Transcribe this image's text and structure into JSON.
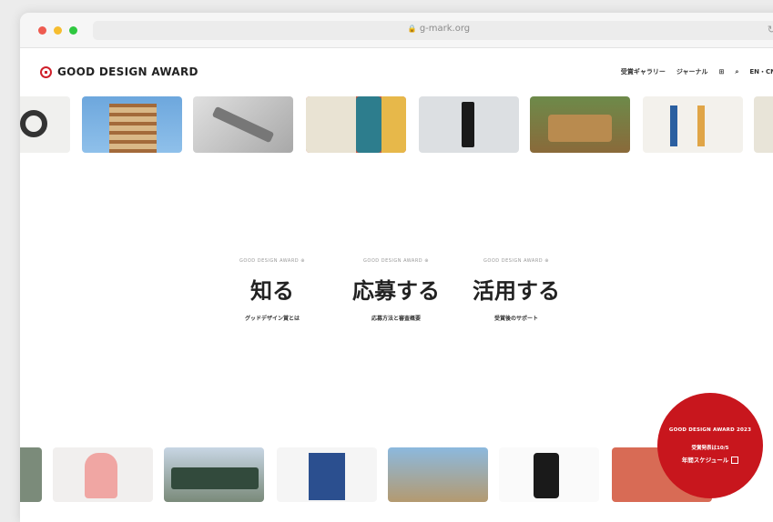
{
  "browser": {
    "url": "g-mark.org",
    "lock_icon": "lock-icon",
    "reload_icon": "reload-icon"
  },
  "header": {
    "logo_text": "GOOD DESIGN AWARD",
    "nav": [
      "受賞ギャラリー",
      "ジャーナル",
      "⊞",
      "⌕",
      "EN・CN"
    ]
  },
  "sections": [
    {
      "tag": "GOOD DESIGN AWARD ⊕",
      "title": "知る",
      "subtitle": "グッドデザイン賞とは"
    },
    {
      "tag": "GOOD DESIGN AWARD ⊕",
      "title": "応募する",
      "subtitle": "応募方法と審査概要"
    },
    {
      "tag": "GOOD DESIGN AWARD ⊕",
      "title": "活用する",
      "subtitle": "受賞後のサポート"
    }
  ],
  "badge": {
    "title": "GOOD DESIGN AWARD 2023",
    "line2": "受賞発表は10/5",
    "line3": "年間スケジュール"
  },
  "colors": {
    "brand_red": "#c8161d"
  }
}
